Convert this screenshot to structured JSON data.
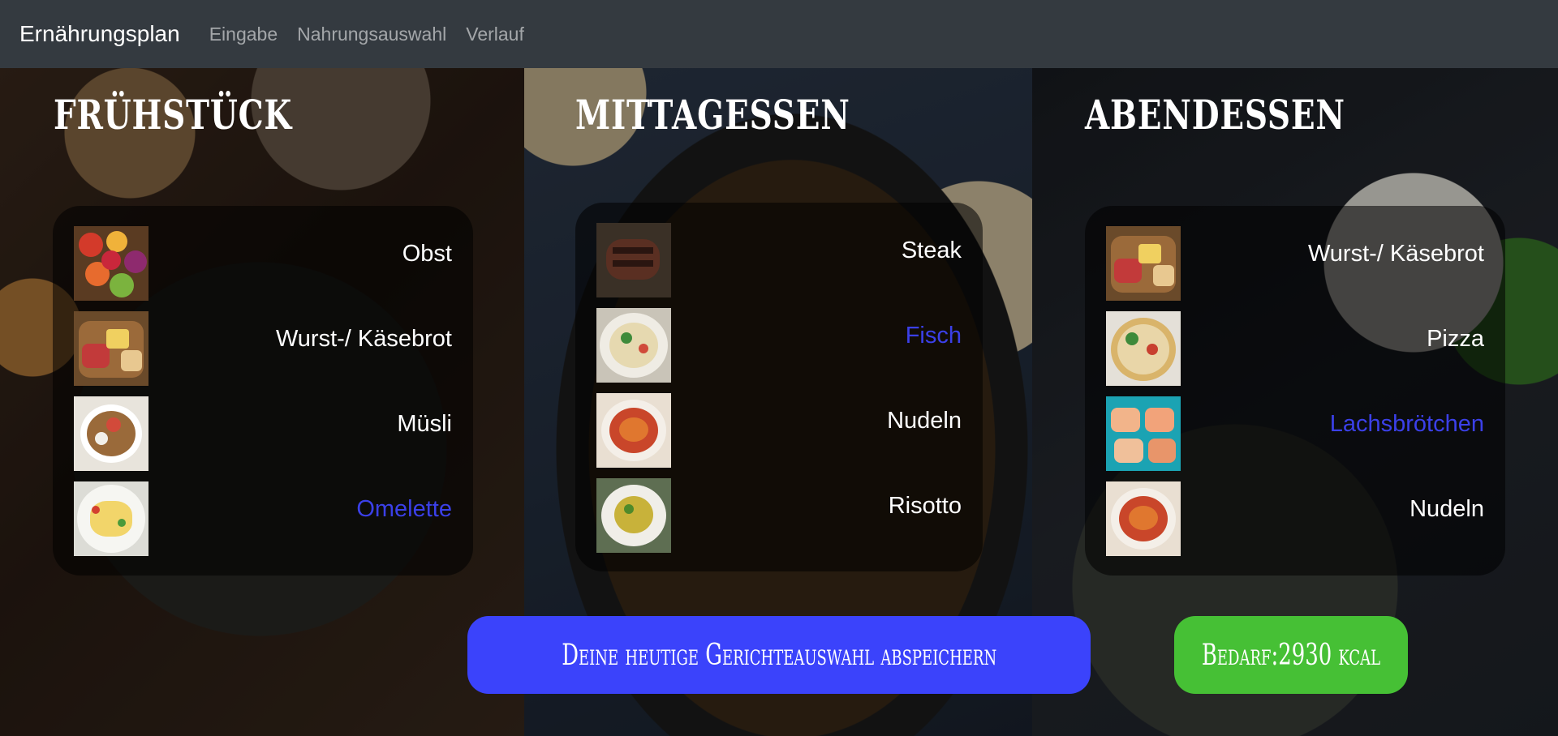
{
  "navbar": {
    "brand": "Ernährungsplan",
    "links": [
      "Eingabe",
      "Nahrungsauswahl",
      "Verlauf"
    ]
  },
  "meals": [
    {
      "title": "FRÜHSTÜCK",
      "items": [
        {
          "label": "Obst",
          "selected": false,
          "icon": "fruit-plate"
        },
        {
          "label": "Wurst-/ Käsebrot",
          "selected": false,
          "icon": "cheese-board"
        },
        {
          "label": "Müsli",
          "selected": false,
          "icon": "muesli-bowl"
        },
        {
          "label": "Omelette",
          "selected": true,
          "icon": "omelette-plate"
        }
      ]
    },
    {
      "title": "MITTAGESSEN",
      "items": [
        {
          "label": "Steak",
          "selected": false,
          "icon": "steak"
        },
        {
          "label": "Fisch",
          "selected": true,
          "icon": "fish-plate"
        },
        {
          "label": "Nudeln",
          "selected": false,
          "icon": "noodles-plate"
        },
        {
          "label": "Risotto",
          "selected": false,
          "icon": "risotto-plate"
        }
      ]
    },
    {
      "title": "ABENDESSEN",
      "items": [
        {
          "label": "Wurst-/ Käsebrot",
          "selected": false,
          "icon": "cheese-board"
        },
        {
          "label": "Pizza",
          "selected": false,
          "icon": "pizza"
        },
        {
          "label": "Lachsbrötchen",
          "selected": true,
          "icon": "salmon-rolls"
        },
        {
          "label": "Nudeln",
          "selected": false,
          "icon": "noodles-plate"
        }
      ]
    }
  ],
  "actions": {
    "save_label": "Deine heutige Gerichteauswahl abspeichern",
    "kcal_label": "Bedarf:2930 kcal"
  },
  "colors": {
    "navbar": "#343a40",
    "selected_item": "#3b40e8",
    "save_button": "#3b43fb",
    "kcal_button": "#46c035"
  }
}
